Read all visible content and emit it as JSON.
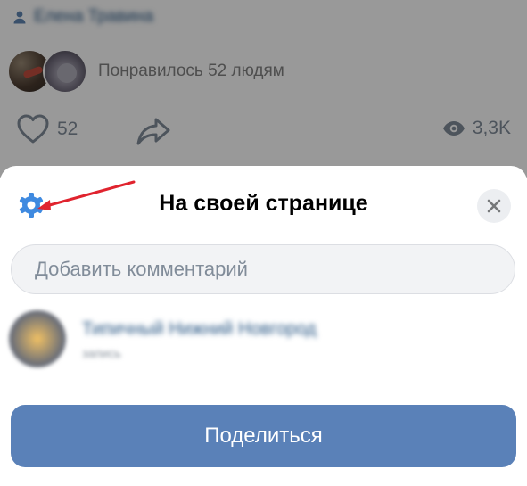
{
  "post": {
    "author_name": "Елена Травина",
    "likes_summary": "Понравилось 52 людям",
    "like_count": "52",
    "views_count": "3,3K"
  },
  "sheet": {
    "title": "На своей странице",
    "comment_placeholder": "Добавить комментарий",
    "target": {
      "name": "Типичный Нижний Новгород",
      "subtitle": "запись"
    },
    "share_label": "Поделиться"
  },
  "colors": {
    "accent": "#5a81b8",
    "gear": "#3f8ae0",
    "annotation_arrow": "#e0232e",
    "secondary_text": "#818c99"
  },
  "icons": [
    "person-icon",
    "heart-icon",
    "share-icon",
    "eye-icon",
    "gear-icon",
    "close-icon",
    "annotation-arrow"
  ]
}
